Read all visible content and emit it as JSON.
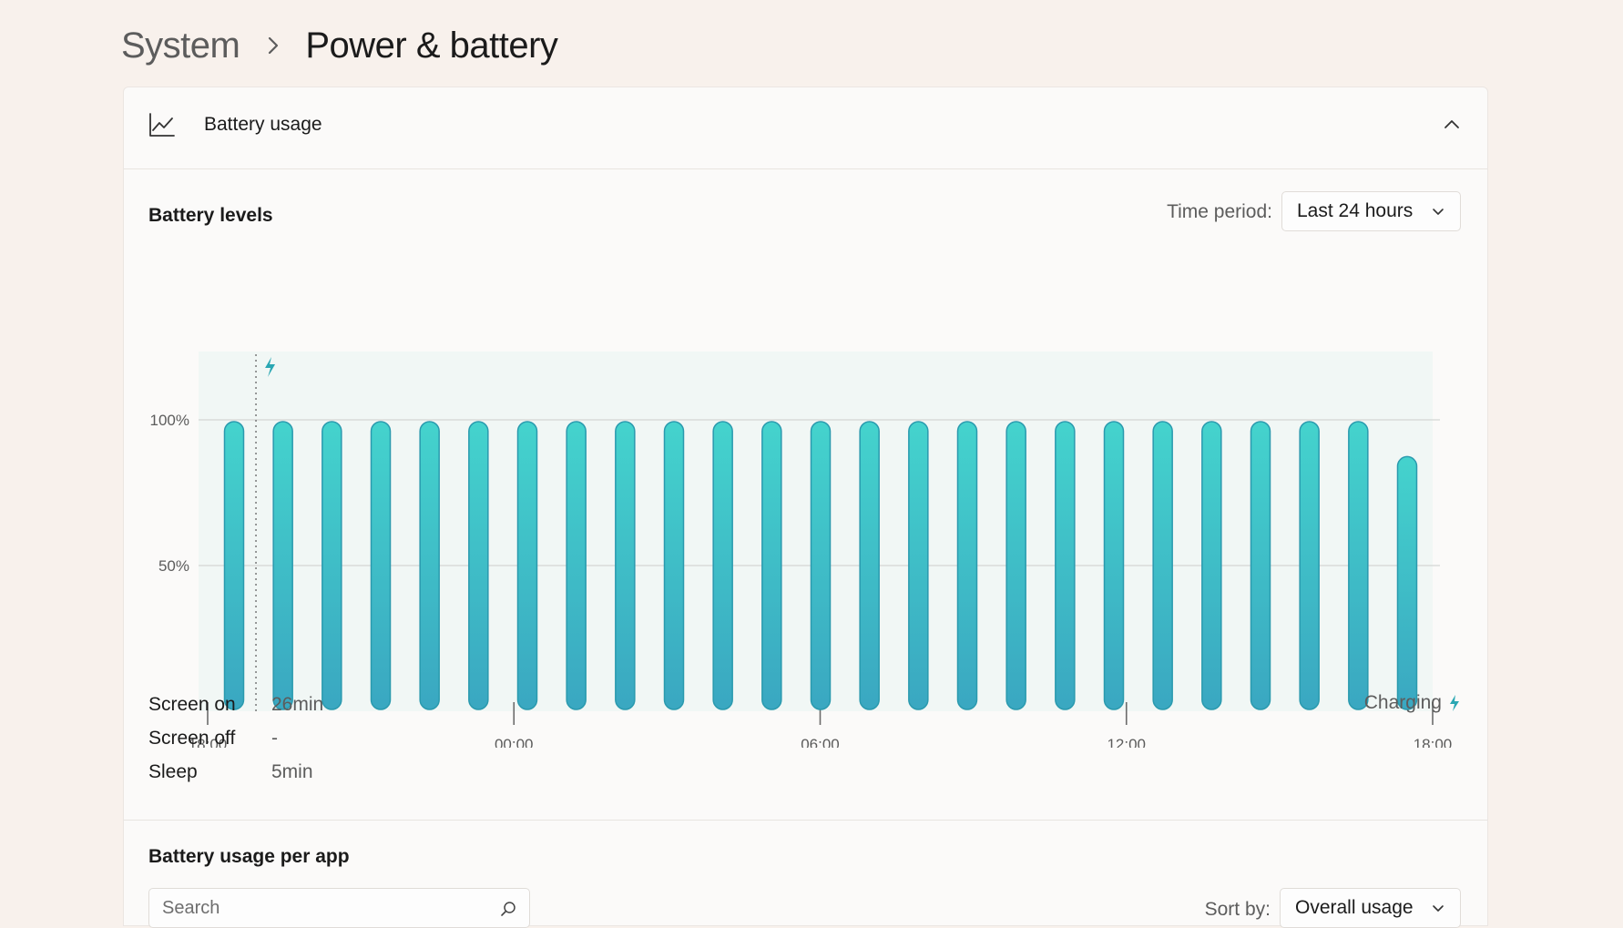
{
  "breadcrumb": {
    "parent": "System",
    "current": "Power & battery"
  },
  "card": {
    "title": "Battery usage",
    "icon": "line-chart-icon",
    "collapse_icon": "chevron-up-icon"
  },
  "levels": {
    "title": "Battery levels",
    "time_period_label": "Time period:",
    "time_period_value": "Last 24 hours"
  },
  "chart_data": {
    "type": "bar",
    "y_ticks": [
      "100%",
      "50%"
    ],
    "x_ticks": [
      "18:00",
      "00:00",
      "06:00",
      "12:00",
      "18:00"
    ],
    "ylim": [
      0,
      100
    ],
    "values": [
      100,
      100,
      100,
      100,
      100,
      100,
      100,
      100,
      100,
      100,
      100,
      100,
      100,
      100,
      100,
      100,
      100,
      100,
      100,
      100,
      100,
      100,
      100,
      100,
      88
    ],
    "charging_marker_hour": 1,
    "bar_color": "#3ec5c6",
    "bar_color_bottom": "#3aa7c1",
    "background_color": "#f1f7f5",
    "grid": true
  },
  "stats": {
    "screen_on_label": "Screen on",
    "screen_on_value": "26min",
    "screen_off_label": "Screen off",
    "screen_off_value": "-",
    "sleep_label": "Sleep",
    "sleep_value": "5min"
  },
  "charging_legend": "Charging",
  "per_app": {
    "title": "Battery usage per app",
    "search_placeholder": "Search",
    "sort_label": "Sort by:",
    "sort_value": "Overall usage"
  },
  "colors": {
    "accent": "#2aa7b3",
    "background": "#f8f1ec"
  }
}
